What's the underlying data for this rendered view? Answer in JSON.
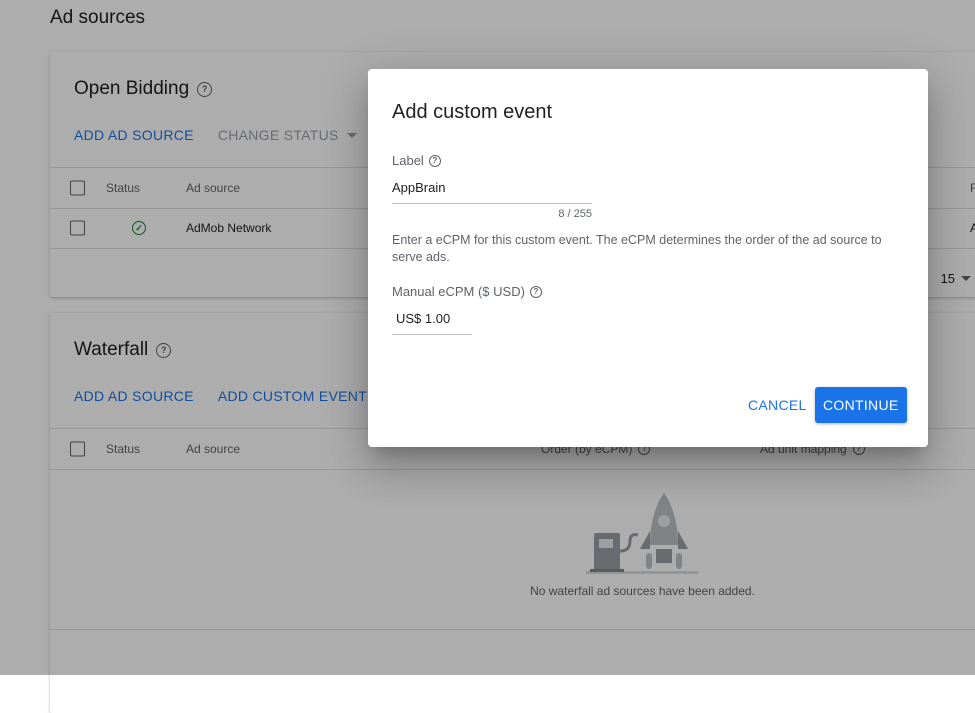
{
  "page": {
    "title": "Ad sources"
  },
  "open_bidding": {
    "title": "Open Bidding",
    "add_ad_source": "ADD AD SOURCE",
    "change_status": "CHANGE STATUS",
    "columns": {
      "status": "Status",
      "ad_source": "Ad source",
      "extra_col": "F"
    },
    "rows": [
      {
        "status": "active",
        "ad_source": "AdMob Network",
        "extra": "A"
      }
    ],
    "page_size": "15"
  },
  "waterfall": {
    "title": "Waterfall",
    "add_ad_source": "ADD AD SOURCE",
    "add_custom_event": "ADD CUSTOM EVENT",
    "columns": {
      "status": "Status",
      "ad_source": "Ad source",
      "order": "Order (by eCPM)",
      "mapping": "Ad unit mapping"
    },
    "empty_message": "No waterfall ad sources have been added."
  },
  "dialog": {
    "title": "Add custom event",
    "label_field": {
      "label": "Label",
      "value": "AppBrain",
      "counter": "8 / 255"
    },
    "description": "Enter a eCPM for this custom event. The eCPM determines the order of the ad source to serve ads.",
    "ecpm_field": {
      "label": "Manual eCPM ($ USD)",
      "value": "US$ 1.00"
    },
    "cancel_label": "CANCEL",
    "continue_label": "CONTINUE"
  },
  "colors": {
    "accent": "#1a73e8",
    "success": "#188038",
    "scrim": "rgba(0,0,0,0.32)"
  }
}
